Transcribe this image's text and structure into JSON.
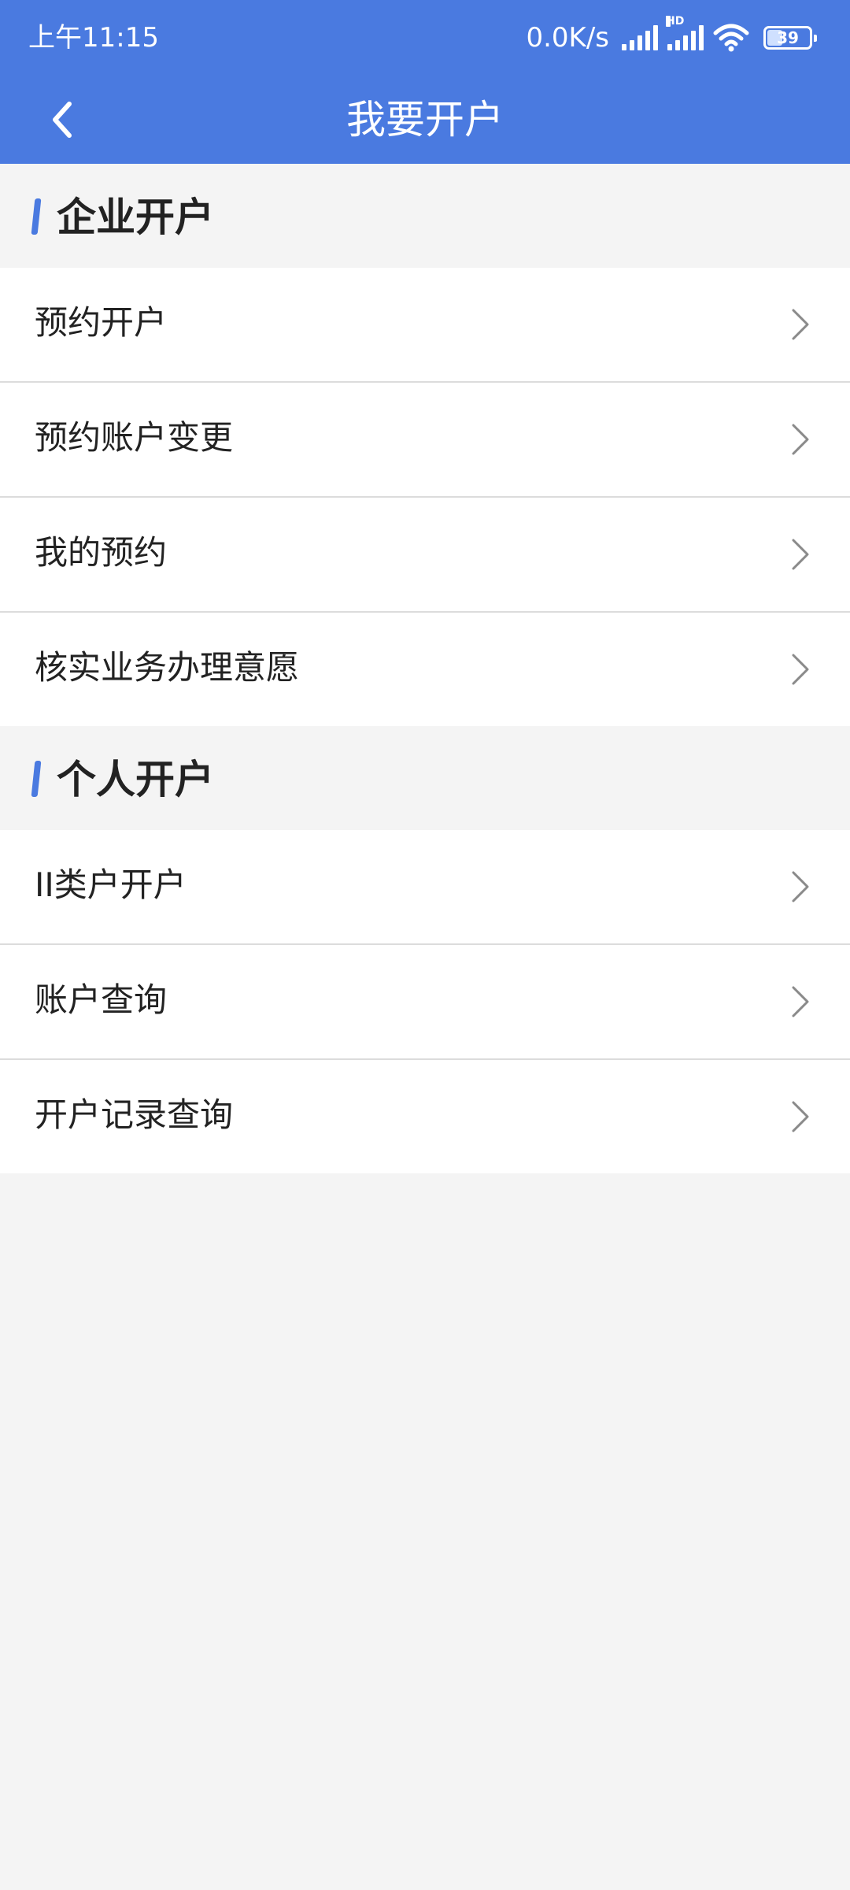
{
  "status_bar": {
    "time": "上午11:15",
    "net_speed": "0.0K/s",
    "hd_label": "HD",
    "battery_level": "39"
  },
  "header": {
    "title": "我要开户"
  },
  "sections": [
    {
      "title": "企业开户",
      "items": [
        {
          "label": "预约开户"
        },
        {
          "label": "预约账户变更"
        },
        {
          "label": "我的预约"
        },
        {
          "label": "核实业务办理意愿"
        }
      ]
    },
    {
      "title": "个人开户",
      "items": [
        {
          "label": "II类户开户"
        },
        {
          "label": "账户查询"
        },
        {
          "label": "开户记录查询"
        }
      ]
    }
  ],
  "colors": {
    "accent": "#4a7ae0",
    "background": "#f4f4f4"
  },
  "icons": {
    "back": "chevron-left-icon",
    "item_arrow": "chevron-right-icon"
  }
}
